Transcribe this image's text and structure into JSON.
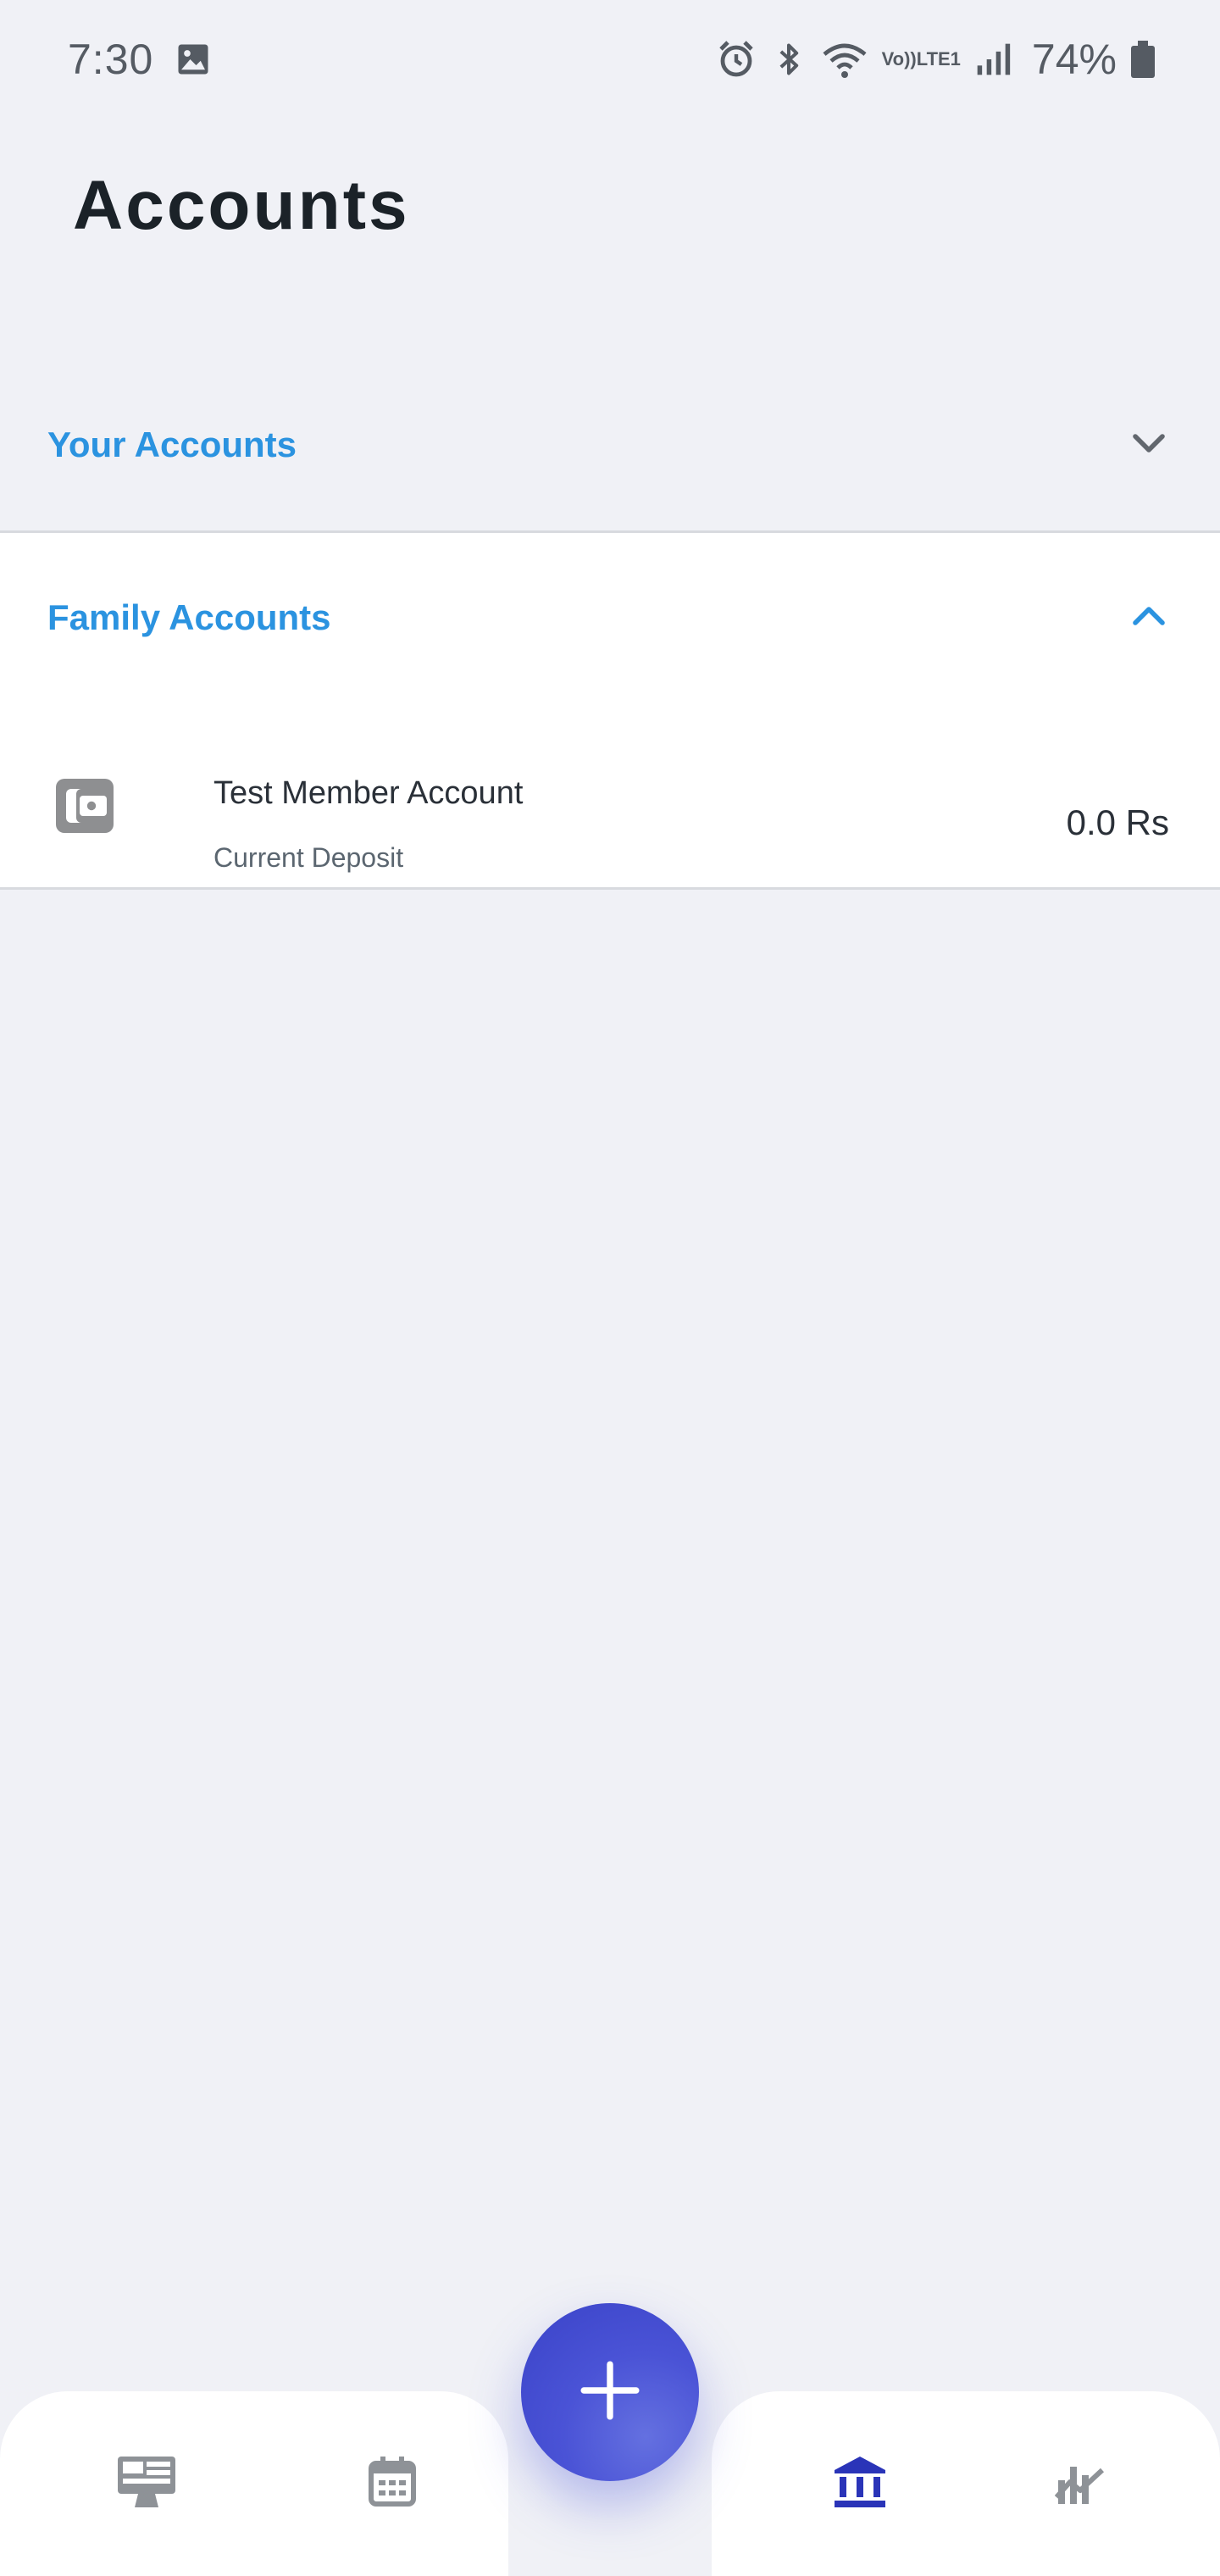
{
  "status_bar": {
    "time": "7:30",
    "volte_line1": "Vo))",
    "volte_line2": "LTE1",
    "battery": "74%"
  },
  "page": {
    "title": "Accounts"
  },
  "sections": {
    "your_accounts": {
      "title": "Your Accounts",
      "expanded": false
    },
    "family_accounts": {
      "title": "Family Accounts",
      "expanded": true,
      "accounts": [
        {
          "name": "Test Member Account",
          "type": "Current Deposit",
          "balance": "0.0 Rs",
          "icon": "wallet-icon"
        }
      ]
    }
  },
  "bottom_nav": {
    "items": [
      {
        "icon": "dashboard-icon",
        "active": false
      },
      {
        "icon": "calendar-icon",
        "active": false
      },
      {
        "icon": "bank-icon",
        "active": true
      },
      {
        "icon": "chart-icon",
        "active": false
      }
    ],
    "fab_icon": "plus-icon"
  },
  "colors": {
    "accent": "#2b93e0",
    "primary": "#3a43c8",
    "background": "#f0f1f6",
    "icon_inactive": "#8e9297"
  }
}
